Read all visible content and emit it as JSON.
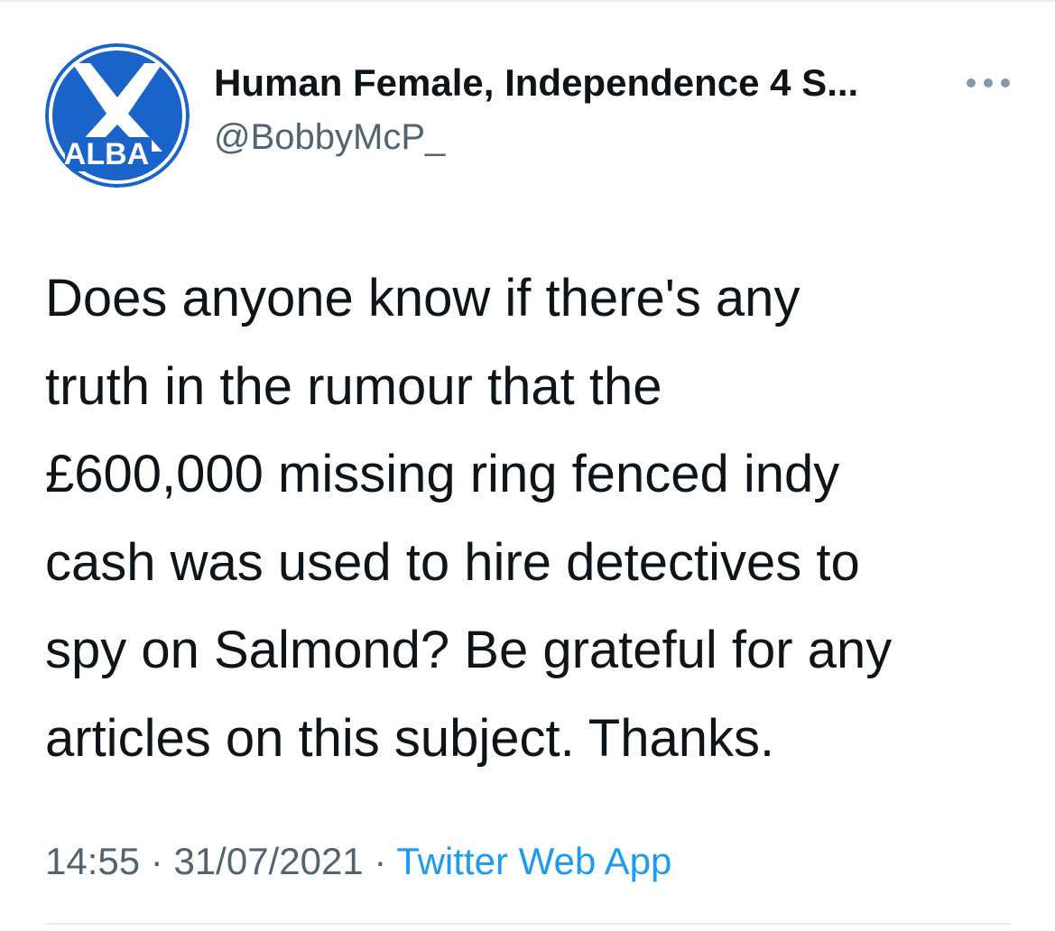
{
  "author": {
    "name": "Human Female, Independence 4 S...",
    "handle": "@BobbyMcP_",
    "avatar_label": "ALBA"
  },
  "tweet": {
    "lines": [
      "Does anyone know if there's any",
      "truth in the rumour that the",
      "£600,000 missing ring fenced indy",
      "cash was used to hire detectives to",
      "spy on Salmond? Be grateful for any",
      "articles on this subject. Thanks."
    ],
    "time": "14:55",
    "date": "31/07/2021",
    "separator": "·",
    "source": "Twitter Web App"
  },
  "icons": {
    "more": "more-horizontal-icon"
  },
  "colors": {
    "link": "#1d9bf0",
    "secondary_text": "#536471",
    "avatar_blue": "#1a63c9",
    "divider": "#e6ecf0"
  }
}
